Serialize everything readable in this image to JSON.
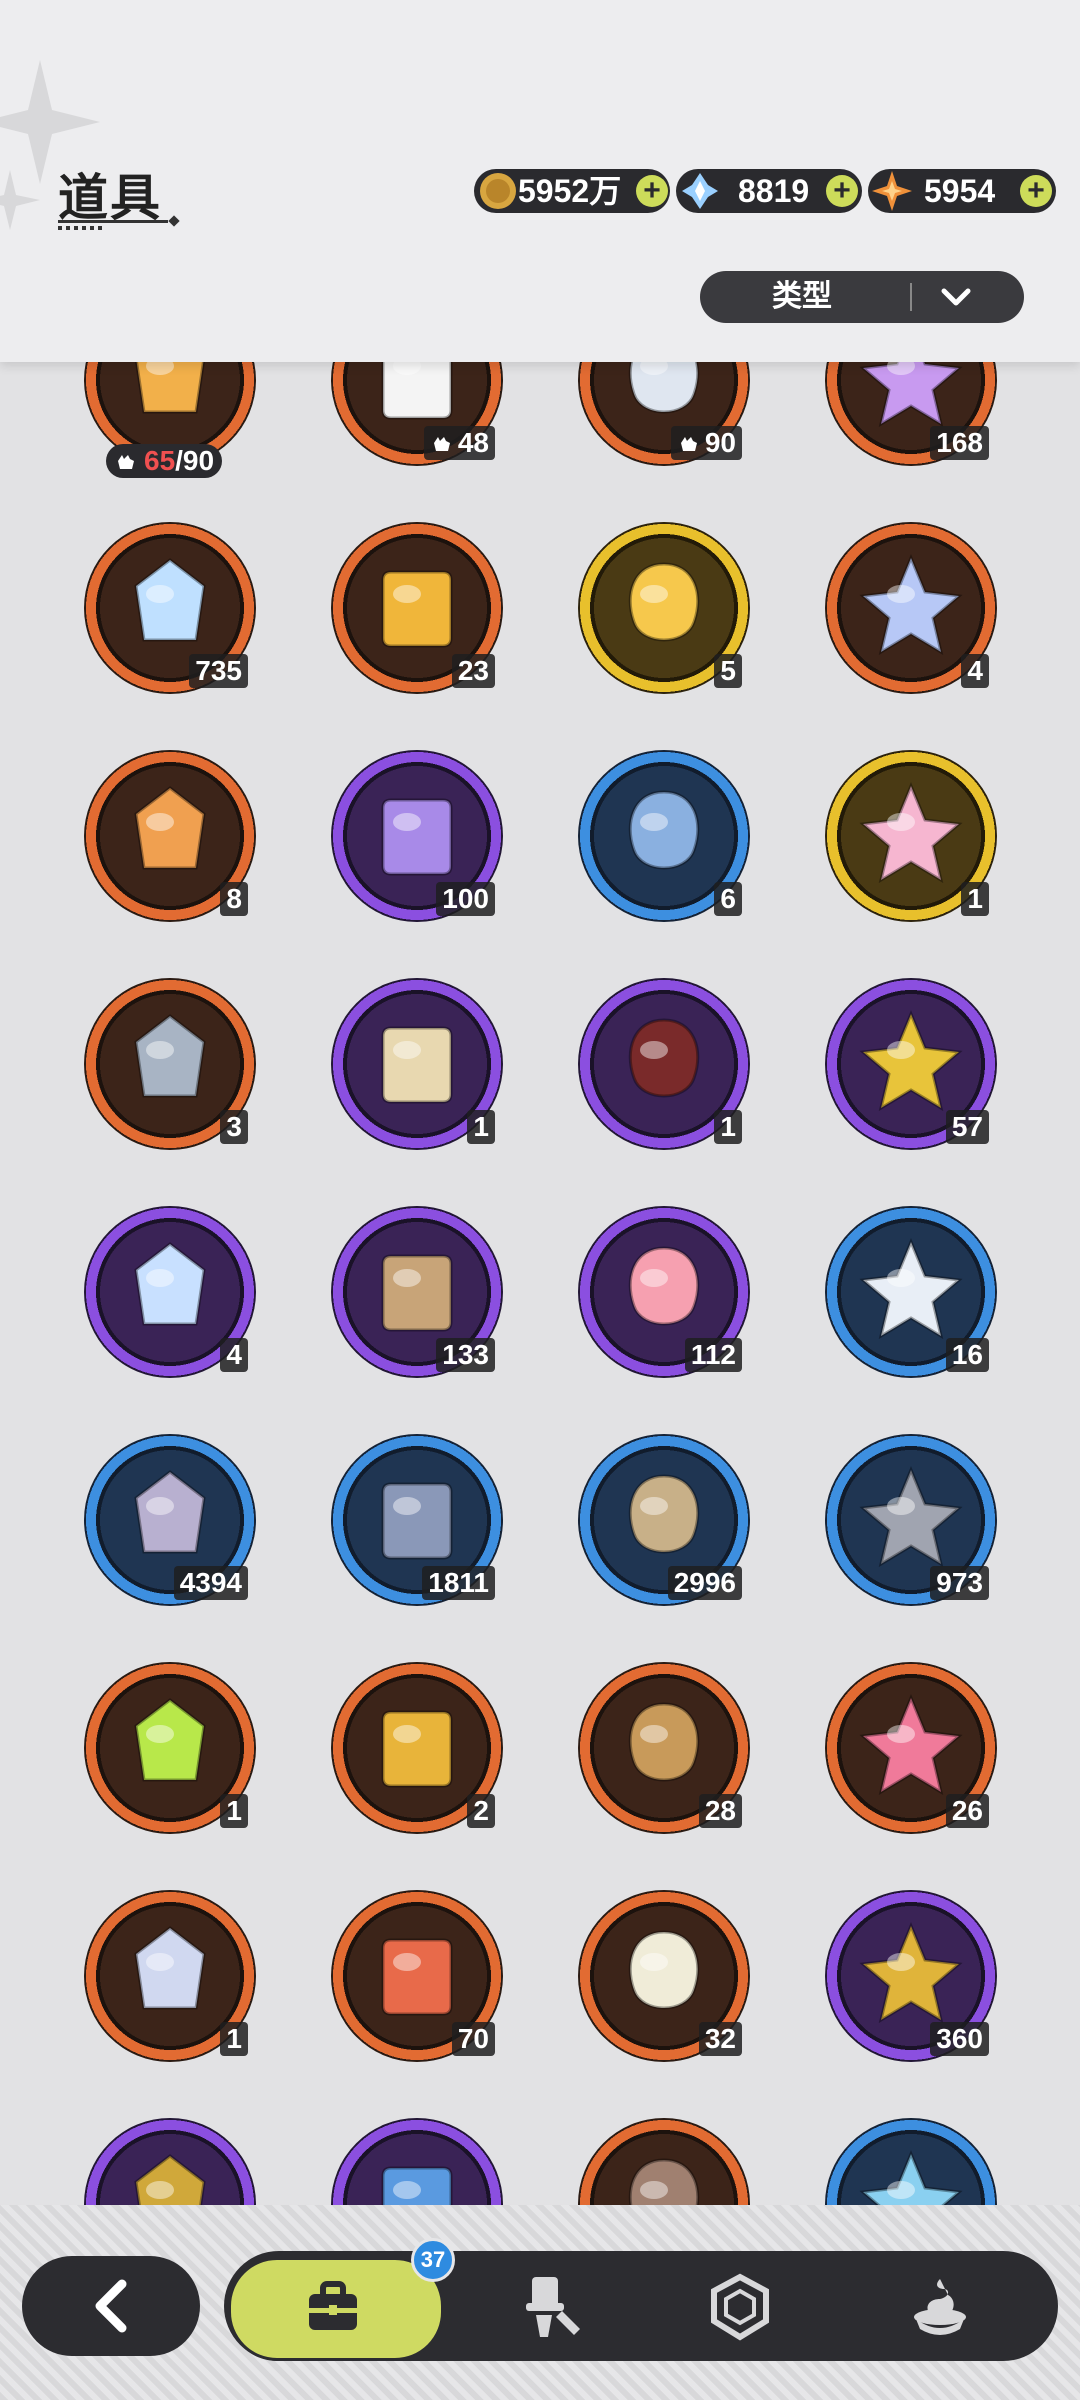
{
  "header": {
    "title": "道具",
    "currencies": [
      {
        "icon": "gold-coin-icon",
        "value": "5952万"
      },
      {
        "icon": "crystal-icon",
        "value": "8819"
      },
      {
        "icon": "star-shard-icon",
        "value": "5954"
      }
    ],
    "type_filter_label": "类型"
  },
  "items": [
    {
      "icon": "mystery-pet-icon",
      "rarity": "orange",
      "qty_current": "65",
      "qty_total": "/90"
    },
    {
      "icon": "panda-fragment-icon",
      "rarity": "orange",
      "qty": "48"
    },
    {
      "icon": "cat-fragment-icon",
      "rarity": "orange",
      "qty": "90"
    },
    {
      "icon": "purple-crystal-icon",
      "rarity": "orange",
      "qty": "168"
    },
    {
      "icon": "ice-crystal-icon",
      "rarity": "orange",
      "qty": "735"
    },
    {
      "icon": "paw-pendant-icon",
      "rarity": "orange",
      "qty": "23"
    },
    {
      "icon": "golden-character-card-icon",
      "rarity": "gold",
      "qty": "5"
    },
    {
      "icon": "rainbow-character-card-icon",
      "rarity": "orange",
      "qty": "4"
    },
    {
      "icon": "orange-character-card-icon",
      "rarity": "orange",
      "qty": "8"
    },
    {
      "icon": "purple-character-card-icon",
      "rarity": "purple",
      "qty": "100"
    },
    {
      "icon": "blue-character-card-icon",
      "rarity": "blue",
      "qty": "6"
    },
    {
      "icon": "birthday-cake-icon",
      "rarity": "gold",
      "qty": "1"
    },
    {
      "icon": "refresh-card-icon",
      "rarity": "orange",
      "qty": "3"
    },
    {
      "icon": "horns-headband-icon",
      "rarity": "purple",
      "qty": "1"
    },
    {
      "icon": "gift-box-icon",
      "rarity": "purple",
      "qty": "1"
    },
    {
      "icon": "golden-egg-icon",
      "rarity": "purple",
      "qty": "57"
    },
    {
      "icon": "magic-mirror-icon",
      "rarity": "purple",
      "qty": "4"
    },
    {
      "icon": "scroll-icon",
      "rarity": "purple",
      "qty": "133"
    },
    {
      "icon": "pink-apple-icon",
      "rarity": "purple",
      "qty": "112"
    },
    {
      "icon": "letter-envelope-icon",
      "rarity": "blue",
      "qty": "16"
    },
    {
      "icon": "shovel-icon",
      "rarity": "blue",
      "qty": "4394"
    },
    {
      "icon": "boxing-glove-icon",
      "rarity": "blue",
      "qty": "1811"
    },
    {
      "icon": "pickaxe-icon",
      "rarity": "blue",
      "qty": "2996"
    },
    {
      "icon": "hammer-icon",
      "rarity": "blue",
      "qty": "973"
    },
    {
      "icon": "green-potion-icon",
      "rarity": "orange",
      "qty": "1"
    },
    {
      "icon": "golden-key-icon",
      "rarity": "orange",
      "qty": "2"
    },
    {
      "icon": "compass-emblem-icon",
      "rarity": "orange",
      "qty": "28"
    },
    {
      "icon": "pink-gem-icon",
      "rarity": "orange",
      "qty": "26"
    },
    {
      "icon": "shirt-coin-icon",
      "rarity": "orange",
      "qty": "1"
    },
    {
      "icon": "wheel-ticket-icon",
      "rarity": "orange",
      "qty": "70"
    },
    {
      "icon": "rainbow-ticket-icon",
      "rarity": "orange",
      "qty": "32"
    },
    {
      "icon": "gold-medal-coin-icon",
      "rarity": "purple",
      "qty": "360"
    },
    {
      "icon": "gold-token-icon",
      "rarity": "purple"
    },
    {
      "icon": "blue-orb-icon",
      "rarity": "purple"
    },
    {
      "icon": "fist-coin-icon",
      "rarity": "orange"
    },
    {
      "icon": "blue-shield-icon",
      "rarity": "blue"
    }
  ],
  "nav": {
    "badge_count": "37",
    "tabs": [
      "bag-icon",
      "outfit-icon",
      "gem-icon",
      "dessert-icon"
    ]
  },
  "colors": {
    "orange": "#e26b32",
    "purple": "#8b4fe0",
    "blue": "#3d8fe0",
    "gold": "#e8c02c",
    "accent": "#cfda62"
  }
}
